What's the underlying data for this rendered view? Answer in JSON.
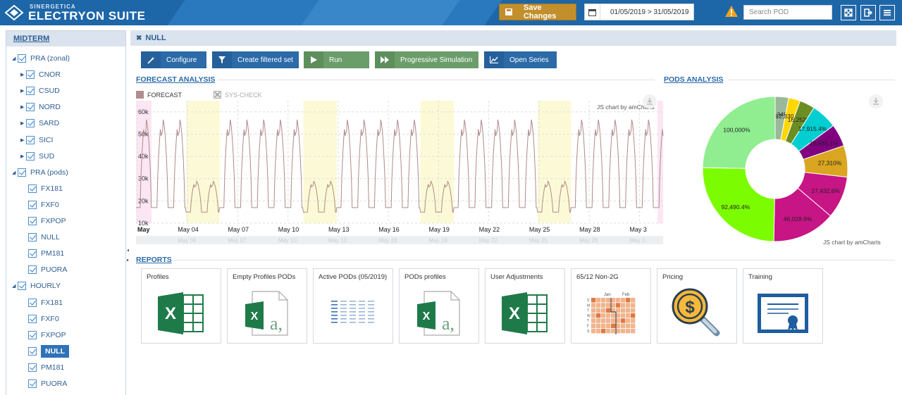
{
  "header": {
    "brand_small": "SINERGETICA",
    "brand_big": "ELECTRYON SUITE",
    "save_label": "Save Changes",
    "date_range": "01/05/2019 > 31/05/2019",
    "search_placeholder": "Search POD",
    "accent": "#1d66a8"
  },
  "sidebar": {
    "title": "MIDTERM",
    "items": [
      {
        "label": "PRA (zonal)",
        "level": 0,
        "expanded": true
      },
      {
        "label": "CNOR",
        "level": 1,
        "collapsed": true
      },
      {
        "label": "CSUD",
        "level": 1,
        "collapsed": true
      },
      {
        "label": "NORD",
        "level": 1,
        "collapsed": true
      },
      {
        "label": "SARD",
        "level": 1,
        "collapsed": true
      },
      {
        "label": "SICI",
        "level": 1,
        "collapsed": true
      },
      {
        "label": "SUD",
        "level": 1,
        "collapsed": true
      },
      {
        "label": "PRA (pods)",
        "level": 0,
        "expanded": true
      },
      {
        "label": "FX181",
        "level": 1
      },
      {
        "label": "FXF0",
        "level": 1
      },
      {
        "label": "FXPOP",
        "level": 1
      },
      {
        "label": "NULL",
        "level": 1
      },
      {
        "label": "PM181",
        "level": 1
      },
      {
        "label": "PUORA",
        "level": 1
      },
      {
        "label": "HOURLY",
        "level": 0,
        "expanded": true
      },
      {
        "label": "FX181",
        "level": 1
      },
      {
        "label": "FXF0",
        "level": 1
      },
      {
        "label": "FXPOP",
        "level": 1
      },
      {
        "label": "NULL",
        "level": 1,
        "selected": true
      },
      {
        "label": "PM181",
        "level": 1
      },
      {
        "label": "PUORA",
        "level": 1
      }
    ]
  },
  "main": {
    "title": "NULL",
    "toolbar": {
      "configure": "Configure",
      "create_filtered": "Create filtered set",
      "run": "Run",
      "progressive": "Progressive Simulation",
      "open_series": "Open Series"
    },
    "forecast_title": "FORECAST ANALYSIS",
    "pods_title": "PODS ANALYSIS",
    "reports_title": "REPORTS",
    "chart_credit": "JS chart by amCharts"
  },
  "chart_data": [
    {
      "type": "line",
      "legend": [
        "FORECAST",
        "SYS-CHECK"
      ],
      "y_ticks": [
        "60k",
        "50k",
        "40k",
        "30k",
        "20k",
        "10k"
      ],
      "ylim": [
        10000,
        65000
      ],
      "x_ticks": [
        "May",
        "May 04",
        "May 07",
        "May 10",
        "May 13",
        "May 16",
        "May 19",
        "May 22",
        "May 25",
        "May 28",
        "May 3"
      ],
      "series": [
        {
          "name": "FORECAST",
          "color": "#b08a8a"
        }
      ],
      "x_start": "2019-05-01",
      "x_end": "2019-05-31",
      "weekend_bands": [
        [
          3.0,
          5.0
        ],
        [
          10.0,
          12.0
        ],
        [
          17.0,
          19.0
        ],
        [
          24.0,
          26.0
        ]
      ]
    },
    {
      "type": "pie",
      "donut": true,
      "labels": [
        "10,349%",
        "12,330.3%",
        "16,252%",
        "17,915.4%",
        "19,685.1%",
        "27,310%",
        "27,432.6%",
        "46,028.6%",
        "92,490.4%",
        "100,000%"
      ],
      "values": [
        3.0,
        2.6,
        3.4,
        5.8,
        5.0,
        7.0,
        9.4,
        14.1,
        25.0,
        24.7
      ],
      "colors": [
        "#9ab89a",
        "#ffd700",
        "#6b8e23",
        "#00ced1",
        "#800080",
        "#daa520",
        "#c71585",
        "#c71585",
        "#7cfc00",
        "#90ee90"
      ]
    }
  ],
  "reports": [
    {
      "label": "Profiles",
      "icon": "excel-icon"
    },
    {
      "label": "Empty Profiles PODs",
      "icon": "excel-file-icon"
    },
    {
      "label": "Active PODs (05/2019)",
      "icon": "table-icon"
    },
    {
      "label": "PODs profiles",
      "icon": "excel-file-icon"
    },
    {
      "label": "User Adjustments",
      "icon": "excel-icon"
    },
    {
      "label": "65/12 Non-2G",
      "icon": "calendar-heatmap-icon"
    },
    {
      "label": "Pricing",
      "icon": "pricing-magnifier-icon"
    },
    {
      "label": "Training",
      "icon": "certificate-icon"
    }
  ],
  "heatmap_months": [
    "Jan",
    "Feb"
  ],
  "heatmap_days": [
    "S",
    "M",
    "T",
    "W",
    "T",
    "F",
    "S"
  ]
}
